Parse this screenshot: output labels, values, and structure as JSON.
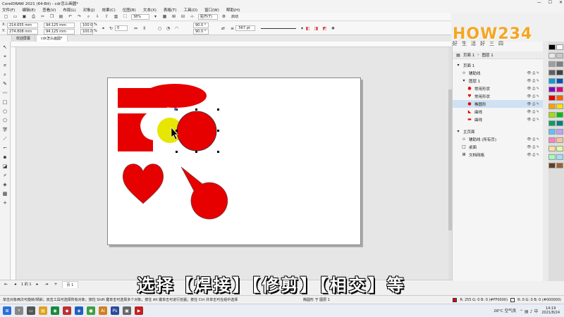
{
  "window": {
    "title": "CorelDRAW 2021 (64-Bit) - cdr怎么画圆*",
    "controls": [
      "—",
      "☐",
      "✕"
    ]
  },
  "menu": [
    "文件(F)",
    "编辑(E)",
    "查看(V)",
    "布局(L)",
    "对象(J)",
    "效果(C)",
    "位图(B)",
    "文本(X)",
    "表格(T)",
    "工具(O)",
    "窗口(W)",
    "帮助(H)"
  ],
  "standard_bar": {
    "zoom": "38%",
    "snap_label": "贴齐(T)",
    "launch_label": "启动"
  },
  "property_bar": {
    "x": "214.655 mm",
    "y": "274.808 mm",
    "w": "94.125 mm",
    "h": "94.125 mm",
    "scale_w": "100.0",
    "scale_h": "100.0",
    "pct": "%",
    "angle": "0",
    "start_angle": "90.0 °",
    "end_angle": "90.0 °",
    "outline": ".567 pt"
  },
  "doc_tabs": [
    "欢迎屏幕",
    "cdr怎么画圆*"
  ],
  "page_nav": {
    "counter": "1 的 1",
    "page_label": "页 1"
  },
  "docker": {
    "header_tabs": [
      "页面 1",
      "图层 1"
    ],
    "rows": [
      {
        "label": "页面 1",
        "level": 0,
        "icon": "▾"
      },
      {
        "label": "辅助线",
        "level": 1,
        "icon": "⊹"
      },
      {
        "label": "图层 1",
        "level": 1,
        "icon": "▾"
      },
      {
        "label": "常用形状",
        "level": 2,
        "icon": "●"
      },
      {
        "label": "常用形状",
        "level": 2,
        "icon": "♥"
      },
      {
        "label": "椭圆形",
        "level": 2,
        "icon": "●"
      },
      {
        "label": "曲线",
        "level": 2,
        "icon": "◣"
      },
      {
        "label": "曲线",
        "level": 2,
        "icon": "▬"
      },
      {
        "label": "主页面",
        "level": 0,
        "icon": "▾"
      },
      {
        "label": "辅助线 (所有页)",
        "level": 1,
        "icon": "⊹"
      },
      {
        "label": "桌面",
        "level": 1,
        "icon": "□"
      },
      {
        "label": "文档网格",
        "level": 1,
        "icon": "⊞"
      }
    ],
    "selected_index": 5
  },
  "palette": [
    "#000000",
    "#ffffff",
    "#e8e8e8",
    "#c8c8c8",
    "#a0a0a0",
    "#808080",
    "#606060",
    "#404040",
    "#00a0e0",
    "#0050c0",
    "#8000c0",
    "#e00080",
    "#e00000",
    "#ff6000",
    "#ffa000",
    "#ffe000",
    "#a0e000",
    "#00c000",
    "#00a060",
    "#008080",
    "#60c0ff",
    "#c0a0ff",
    "#ff80c0",
    "#ffc0a0",
    "#ffe0a0",
    "#e0ffa0",
    "#a0ffc0",
    "#a0e0ff",
    "#604020",
    "#a06030"
  ],
  "shapes": {
    "fill_red": "#e60000",
    "fill_yellow": "#e6e600",
    "outline": "#333333"
  },
  "subtitle": "选择【焊接】【修剪】【相交】等",
  "watermark": {
    "logo": "HOW234",
    "tagline": "好生活好三四"
  },
  "status": {
    "hint": "单击对象两次可旋转/倾斜；双击工具可选择所有对象；按住 Shift 键单击可选择多个对象；按住 Alt 键单击可进行挖掘；按住 Ctrl 并单击可在组中选择",
    "object": "椭圆形 于 图层 1",
    "fill_info": "R: 255 G: 0 B: 0 (#FF0000)",
    "outline_info": "R: 0 G: 0 B: 0 (#000000)"
  },
  "taskbar": {
    "weather": "28°C 空气良",
    "time": "14:19",
    "date": "2021/8/24"
  }
}
